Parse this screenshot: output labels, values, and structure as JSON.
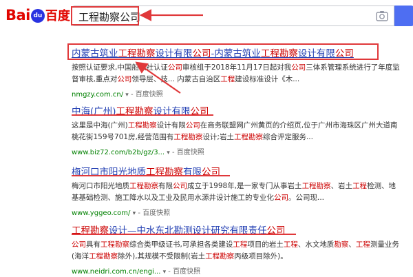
{
  "header": {
    "logo_bai": "Bai",
    "logo_du": "du",
    "logo_cn": "百度",
    "search_value": "工程勘察公司"
  },
  "results": [
    {
      "title_parts": [
        {
          "t": "内蒙古筑业",
          "em": false
        },
        {
          "t": "工程勘察",
          "em": true
        },
        {
          "t": "设计有限",
          "em": false
        },
        {
          "t": "公司",
          "em": true
        },
        {
          "t": "-内蒙古筑业",
          "em": false
        },
        {
          "t": "工程勘察",
          "em": true
        },
        {
          "t": "设计有限",
          "em": false
        },
        {
          "t": "公司",
          "em": true
        }
      ],
      "abstract_parts": [
        {
          "t": "按照认证要求,中国船级社认证",
          "em": false
        },
        {
          "t": "公司",
          "em": true
        },
        {
          "t": "审核组于2018年11月17日起对我",
          "em": false
        },
        {
          "t": "公司",
          "em": true
        },
        {
          "t": "三体系管理系统进行了年度监督审核,重点对",
          "em": false
        },
        {
          "t": "公司",
          "em": true
        },
        {
          "t": "领导层、技... 内蒙古自治区",
          "em": false
        },
        {
          "t": "工程",
          "em": true
        },
        {
          "t": "建设标准设计《木...",
          "em": false
        }
      ],
      "url": "nmgzy.com.cn/",
      "arrow": "▾",
      "dash": "-",
      "snapshot": "百度快照"
    },
    {
      "title_parts": [
        {
          "t": "中海(广州)",
          "em": false
        },
        {
          "t": "工程勘察",
          "em": true
        },
        {
          "t": "设计有限",
          "em": false
        },
        {
          "t": "公司",
          "em": true
        }
      ],
      "abstract_parts": [
        {
          "t": "这里是中海(广州)",
          "em": false
        },
        {
          "t": "工程勘察",
          "em": true
        },
        {
          "t": "设计有限",
          "em": false
        },
        {
          "t": "公司",
          "em": true
        },
        {
          "t": "在商务联盟网广州黄页的介绍页,位于广州市海珠区广州大道南桃花街159号701房,经营范围有",
          "em": false
        },
        {
          "t": "工程勘察",
          "em": true
        },
        {
          "t": "设计;岩土",
          "em": false
        },
        {
          "t": "工程勘察",
          "em": true
        },
        {
          "t": "综合评定服务...",
          "em": false
        }
      ],
      "url": "www.biz72.com/b2b/gz/3...",
      "arrow": "▾",
      "dash": "-",
      "snapshot": "百度快照"
    },
    {
      "title_parts": [
        {
          "t": "梅河口市阳光地质",
          "em": false
        },
        {
          "t": "工程勘察",
          "em": true
        },
        {
          "t": "有限",
          "em": false
        },
        {
          "t": "公司",
          "em": true
        }
      ],
      "abstract_parts": [
        {
          "t": "梅河口市阳光地质",
          "em": false
        },
        {
          "t": "工程勘察",
          "em": true
        },
        {
          "t": "有限",
          "em": false
        },
        {
          "t": "公司",
          "em": true
        },
        {
          "t": "成立于1998年,是一家专门从事岩土",
          "em": false
        },
        {
          "t": "工程勘察",
          "em": true
        },
        {
          "t": "、岩土",
          "em": false
        },
        {
          "t": "工程",
          "em": true
        },
        {
          "t": "检测、地基基础检测、施工降水以及工业及民用水源井设计施工的专业化",
          "em": false
        },
        {
          "t": "公司",
          "em": true
        },
        {
          "t": "。公司现...",
          "em": false
        }
      ],
      "url": "www.yggeo.com/",
      "arrow": "▾",
      "dash": "-",
      "snapshot": "百度快照"
    },
    {
      "title_parts": [
        {
          "t": "工程勘察",
          "em": true
        },
        {
          "t": "设计—中水东北勘测设计研究有限责任",
          "em": false
        },
        {
          "t": "公司",
          "em": true
        }
      ],
      "abstract_parts": [
        {
          "t": "公司",
          "em": true
        },
        {
          "t": "具有",
          "em": false
        },
        {
          "t": "工程勘察",
          "em": true
        },
        {
          "t": "综合类甲级证书,可承担各类建设",
          "em": false
        },
        {
          "t": "工程",
          "em": true
        },
        {
          "t": "项目的岩土",
          "em": false
        },
        {
          "t": "工程",
          "em": true
        },
        {
          "t": "、水文地质",
          "em": false
        },
        {
          "t": "勘察",
          "em": true
        },
        {
          "t": "、",
          "em": false
        },
        {
          "t": "工程",
          "em": true
        },
        {
          "t": "测量业务(海洋",
          "em": false
        },
        {
          "t": "工程勘察",
          "em": true
        },
        {
          "t": "除外),其规模不受限制(岩土",
          "em": false
        },
        {
          "t": "工程勘察",
          "em": true
        },
        {
          "t": "丙级项目除外)。",
          "em": false
        }
      ],
      "url": "www.neidri.com.cn/engi...",
      "arrow": "▾",
      "dash": "-",
      "snapshot": "百度快照"
    }
  ],
  "colors": {
    "brand_red": "#e10601",
    "link_blue": "#2440b3",
    "highlight_red": "#c00",
    "url_green": "#008000",
    "annotation_red": "#e0383a"
  }
}
